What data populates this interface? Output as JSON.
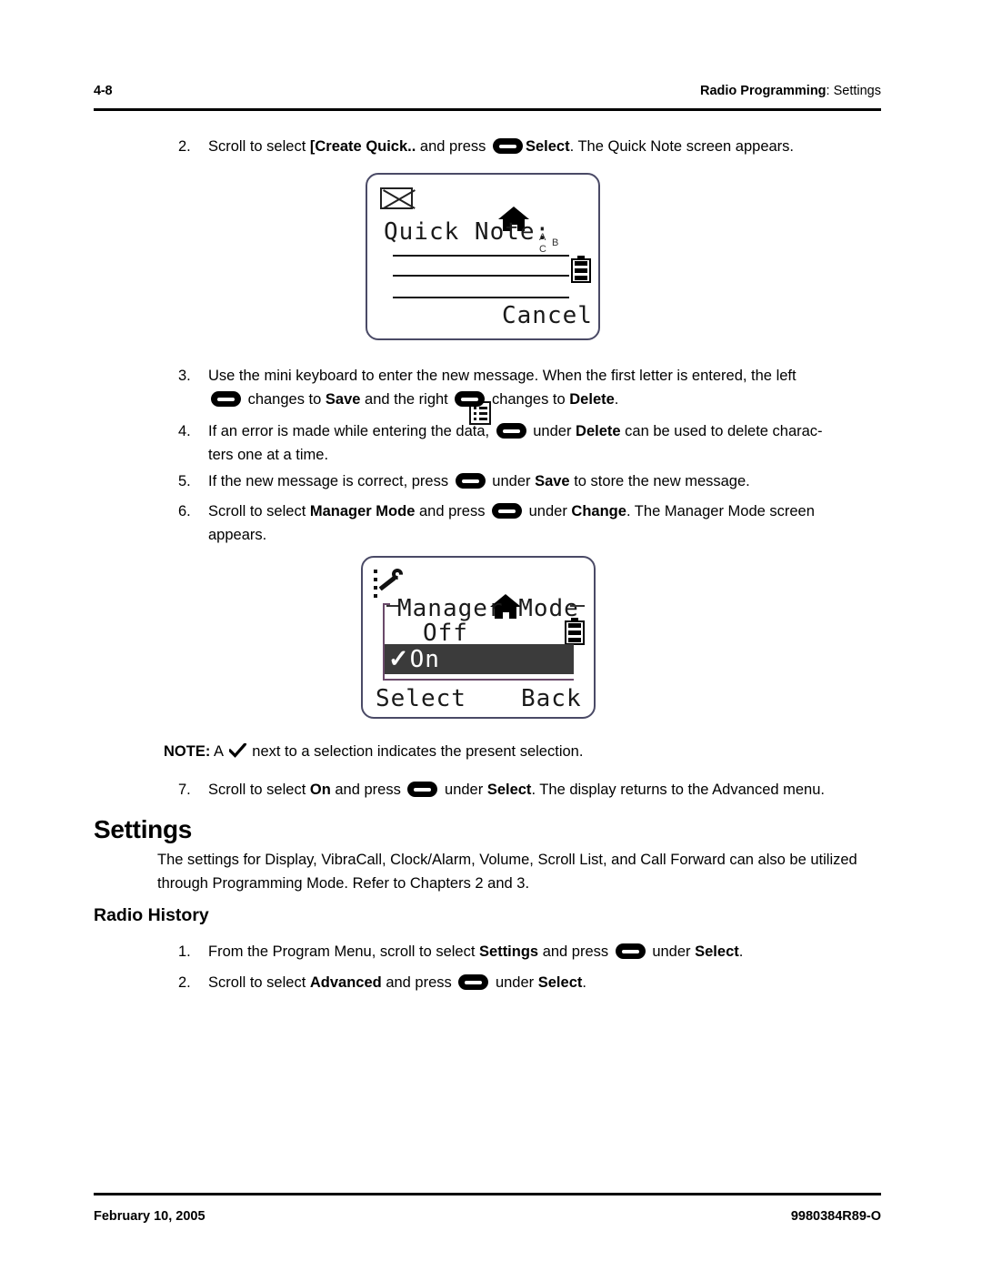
{
  "header": {
    "page_number": "4-8",
    "section_bold": "Radio Programming",
    "section_rest": ": Settings"
  },
  "footer": {
    "date": "February 10, 2005",
    "doc_id": "9980384R89-O"
  },
  "steps": {
    "step2": {
      "num": "2.",
      "t1": "Scroll to select ",
      "b1": "[Create Quick..",
      "t2": " and press ",
      "b2": "Select",
      "t3": ". The Quick Note screen appears."
    },
    "step3": {
      "num": "3.",
      "t1": "Use the mini keyboard to enter the new message. When the first letter is entered, the left ",
      "t2": " changes to ",
      "b1": "Save",
      "t3": " and the right ",
      "t4": " changes to ",
      "b2": "Delete",
      "t5": "."
    },
    "step4": {
      "num": "4.",
      "t1": "If an error is made while entering the data, ",
      "t2": " under ",
      "b1": "Delete",
      "t3": " can be used to delete charac-",
      "t4": "ters one at a time."
    },
    "step5": {
      "num": "5.",
      "t1": "If the new message is correct, press ",
      "t2": " under ",
      "b1": "Save",
      "t3": " to store the new message."
    },
    "step6": {
      "num": "6.",
      "t1": "Scroll to select ",
      "b1": "Manager Mode",
      "t2": " and press ",
      "t3": " under ",
      "b2": "Change",
      "t4": ". The Manager Mode screen",
      "t5": "appears."
    },
    "step7": {
      "num": "7.",
      "t1": "Scroll to select ",
      "b1": "On",
      "t2": " and press ",
      "t3": " under ",
      "b2": "Select",
      "t4": ". The display returns to the Advanced menu."
    },
    "rh_step1": {
      "num": "1.",
      "t1": "From the Program Menu, scroll to select ",
      "b1": "Settings",
      "t2": " and press ",
      "t3": " under ",
      "b2": "Select",
      "t4": "."
    },
    "rh_step2": {
      "num": "2.",
      "t1": "Scroll to select ",
      "b1": "Advanced",
      "t2": " and press ",
      "t3": " under ",
      "b2": "Select",
      "t4": "."
    }
  },
  "note": {
    "label": "NOTE:",
    "t1": " A ",
    "t2": " next to a selection indicates the present selection."
  },
  "headings": {
    "settings": "Settings",
    "radio_history": "Radio History"
  },
  "settings_para": {
    "line1": "The settings for Display, VibraCall, Clock/Alarm, Volume, Scroll List, and Call Forward can also be",
    "line2": "utilized through Programming Mode. Refer to Chapters 2 and 3."
  },
  "lcd_quick_note": {
    "status_icons": [
      "envelope-icon",
      "home-icon",
      "abc-rotate-icon",
      "battery-icon"
    ],
    "abc": {
      "a": "A",
      "b": "B",
      "c": "C"
    },
    "title": "Quick Note:",
    "softkey_right": "Cancel",
    "softkey_left_icon": "menu-list-icon",
    "input_lines": 3
  },
  "lcd_manager_mode": {
    "status_icons": [
      "wrench-programming-icon",
      "home-icon",
      "battery-icon"
    ],
    "title": "Manager Mode",
    "title_left_dash": "—",
    "title_right_dash": "—",
    "options": [
      {
        "label": "Off",
        "selected": false,
        "check": ""
      },
      {
        "label": "On",
        "selected": true,
        "check": "✓"
      }
    ],
    "softkey_left": "Select",
    "softkey_right": "Back"
  },
  "colors": {
    "lcd_border": "#4a4a66",
    "highlight_bg": "#3b3b3b",
    "frame": "#6a4a6a",
    "text": "#000000"
  }
}
